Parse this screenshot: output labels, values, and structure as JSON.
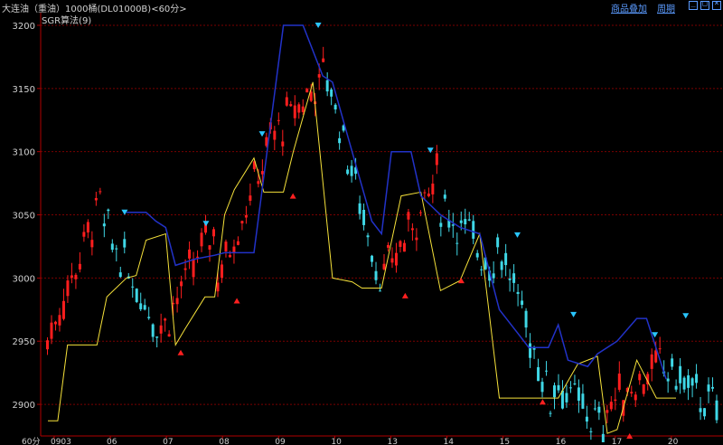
{
  "header": {
    "title": "大连油（重油）1000桶(DL01000B)<60分>",
    "links": [
      "商品叠加",
      "周期"
    ],
    "window_buttons": [
      "minimize-icon",
      "restore-icon",
      "close-icon"
    ]
  },
  "indicator": {
    "label": "SGR算法(9)"
  },
  "colors": {
    "background": "#000000",
    "grid": "#7a0000",
    "axis": "#b00000",
    "up_candle": "#ff1e1e",
    "down_candle": "#3fd7e6",
    "support_line": "#f5e13a",
    "resistance_line": "#2232c8",
    "buy_marker": "#ff2020",
    "sell_marker": "#29c6ff"
  },
  "chart_data": {
    "type": "candlestick",
    "period_label": "60分",
    "y_ticks": [
      2900,
      2950,
      3000,
      3050,
      3100,
      3150,
      3200
    ],
    "ylim": [
      2875,
      3210
    ],
    "x_tick_labels": [
      "0903",
      "06",
      "07",
      "08",
      "09",
      "10",
      "13",
      "14",
      "15",
      "16",
      "17",
      "20"
    ],
    "grid": true,
    "session_closes": [
      {
        "session": "0903",
        "start": 2950,
        "end": 3060,
        "high": 3112,
        "low": 2935,
        "color": "up"
      },
      {
        "session": "06",
        "start": 3040,
        "end": 2965,
        "high": 3055,
        "low": 2935,
        "color": "down"
      },
      {
        "session": "07",
        "start": 2960,
        "end": 3040,
        "high": 3050,
        "low": 2940,
        "color": "up"
      },
      {
        "session": "08",
        "start": 3000,
        "end": 3100,
        "high": 3115,
        "low": 2985,
        "color": "up"
      },
      {
        "session": "09",
        "start": 3110,
        "end": 3160,
        "high": 3196,
        "low": 3080,
        "color": "up"
      },
      {
        "session": "10",
        "start": 3160,
        "end": 3000,
        "high": 3165,
        "low": 2990,
        "color": "down"
      },
      {
        "session": "13",
        "start": 3000,
        "end": 3080,
        "high": 3108,
        "low": 2990,
        "color": "up"
      },
      {
        "session": "14",
        "start": 3060,
        "end": 3010,
        "high": 3070,
        "low": 2985,
        "color": "down"
      },
      {
        "session": "15",
        "start": 3030,
        "end": 2905,
        "high": 3035,
        "low": 2890,
        "color": "down"
      },
      {
        "session": "16",
        "start": 2920,
        "end": 2880,
        "high": 2960,
        "low": 2870,
        "color": "down"
      },
      {
        "session": "17",
        "start": 2900,
        "end": 2930,
        "high": 2965,
        "low": 2880,
        "color": "up"
      },
      {
        "session": "20",
        "start": 2930,
        "end": 2895,
        "high": 2940,
        "low": 2885,
        "color": "down"
      }
    ],
    "support_line": [
      [
        0,
        2887
      ],
      [
        1,
        2887
      ],
      [
        2,
        2947
      ],
      [
        4,
        2947
      ],
      [
        5,
        2947
      ],
      [
        6,
        2985
      ],
      [
        8,
        3000
      ],
      [
        9,
        3002
      ],
      [
        10,
        3030
      ],
      [
        12,
        3035
      ],
      [
        13,
        2947
      ],
      [
        14,
        2960
      ],
      [
        16,
        2985
      ],
      [
        17,
        2985
      ],
      [
        18,
        3050
      ],
      [
        19,
        3070
      ],
      [
        21,
        3095
      ],
      [
        22,
        3068
      ],
      [
        24,
        3068
      ],
      [
        25,
        3100
      ],
      [
        27,
        3155
      ],
      [
        29,
        3000
      ],
      [
        31,
        2997
      ],
      [
        32,
        2992
      ],
      [
        34,
        2992
      ],
      [
        36,
        3065
      ],
      [
        38,
        3068
      ],
      [
        40,
        2990
      ],
      [
        42,
        2998
      ],
      [
        44,
        3035
      ],
      [
        46,
        2905
      ],
      [
        48,
        2905
      ],
      [
        50,
        2905
      ],
      [
        52,
        2905
      ],
      [
        54,
        2932
      ],
      [
        56,
        2938
      ],
      [
        57,
        2877
      ],
      [
        58,
        2880
      ],
      [
        60,
        2935
      ],
      [
        62,
        2905
      ],
      [
        64,
        2905
      ]
    ],
    "resistance_line": [
      [
        8,
        3052
      ],
      [
        10,
        3052
      ],
      [
        11,
        3045
      ],
      [
        12,
        3040
      ],
      [
        13,
        3010
      ],
      [
        15,
        3015
      ],
      [
        17,
        3018
      ],
      [
        18,
        3020
      ],
      [
        19,
        3020
      ],
      [
        21,
        3020
      ],
      [
        24,
        3200
      ],
      [
        26,
        3200
      ],
      [
        28,
        3160
      ],
      [
        29,
        3155
      ],
      [
        31,
        3100
      ],
      [
        33,
        3045
      ],
      [
        34,
        3035
      ],
      [
        35,
        3100
      ],
      [
        37,
        3100
      ],
      [
        38,
        3065
      ],
      [
        40,
        3050
      ],
      [
        42,
        3040
      ],
      [
        44,
        3035
      ],
      [
        46,
        2975
      ],
      [
        48,
        2955
      ],
      [
        49,
        2945
      ],
      [
        51,
        2945
      ],
      [
        52,
        2963
      ],
      [
        53,
        2935
      ],
      [
        55,
        2930
      ],
      [
        56,
        2940
      ],
      [
        58,
        2950
      ],
      [
        60,
        2968
      ],
      [
        61,
        2968
      ],
      [
        63,
        2920
      ]
    ],
    "markers": [
      {
        "type": "sell",
        "price": 3052,
        "session": "06"
      },
      {
        "type": "buy",
        "price": 2941,
        "session": "07"
      },
      {
        "type": "sell",
        "price": 3043,
        "session": "07"
      },
      {
        "type": "buy",
        "price": 2982,
        "session": "08"
      },
      {
        "type": "sell",
        "price": 3114,
        "session": "08"
      },
      {
        "type": "buy",
        "price": 3065,
        "session": "09"
      },
      {
        "type": "sell",
        "price": 3200,
        "session": "09"
      },
      {
        "type": "buy",
        "price": 2986,
        "session": "13"
      },
      {
        "type": "sell",
        "price": 3101,
        "session": "13"
      },
      {
        "type": "buy",
        "price": 2998,
        "session": "14"
      },
      {
        "type": "sell",
        "price": 3034,
        "session": "15"
      },
      {
        "type": "buy",
        "price": 2902,
        "session": "15"
      },
      {
        "type": "sell",
        "price": 2971,
        "session": "16"
      },
      {
        "type": "buy",
        "price": 2875,
        "session": "17"
      },
      {
        "type": "sell",
        "price": 2955,
        "session": "17"
      },
      {
        "type": "sell",
        "price": 2970,
        "session": "20"
      }
    ]
  }
}
